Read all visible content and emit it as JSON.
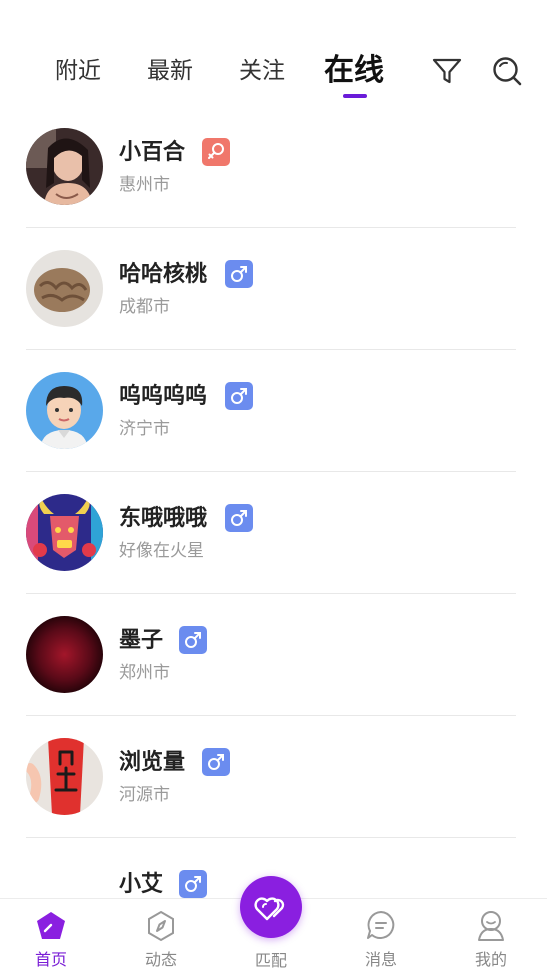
{
  "tabs": [
    {
      "label": "附近",
      "active": false
    },
    {
      "label": "最新",
      "active": false
    },
    {
      "label": "关注",
      "active": false
    },
    {
      "label": "在线",
      "active": true
    }
  ],
  "toolbar": {
    "filter_icon": "filter-icon",
    "search_icon": "search-icon"
  },
  "users": [
    {
      "name": "小百合",
      "city": "惠州市",
      "gender": "female",
      "avatar": "photo-woman"
    },
    {
      "name": "哈哈核桃",
      "city": "成都市",
      "gender": "male",
      "avatar": "walnut"
    },
    {
      "name": "呜呜呜呜",
      "city": "济宁市",
      "gender": "male",
      "avatar": "cartoon-boy"
    },
    {
      "name": "东哦哦哦",
      "city": "好像在火星",
      "gender": "male",
      "avatar": "bull-art"
    },
    {
      "name": "墨子",
      "city": "郑州市",
      "gender": "male",
      "avatar": "dark-red"
    },
    {
      "name": "浏览量",
      "city": "河源市",
      "gender": "male",
      "avatar": "red-couplet"
    },
    {
      "name": "小艾",
      "city": "",
      "gender": "male",
      "avatar": "none"
    }
  ],
  "nav": {
    "home": "首页",
    "feed": "动态",
    "match": "匹配",
    "messages": "消息",
    "mine": "我的"
  },
  "colors": {
    "accent": "#7a1ed6",
    "male": "#6b8cef",
    "female": "#f0776b"
  }
}
